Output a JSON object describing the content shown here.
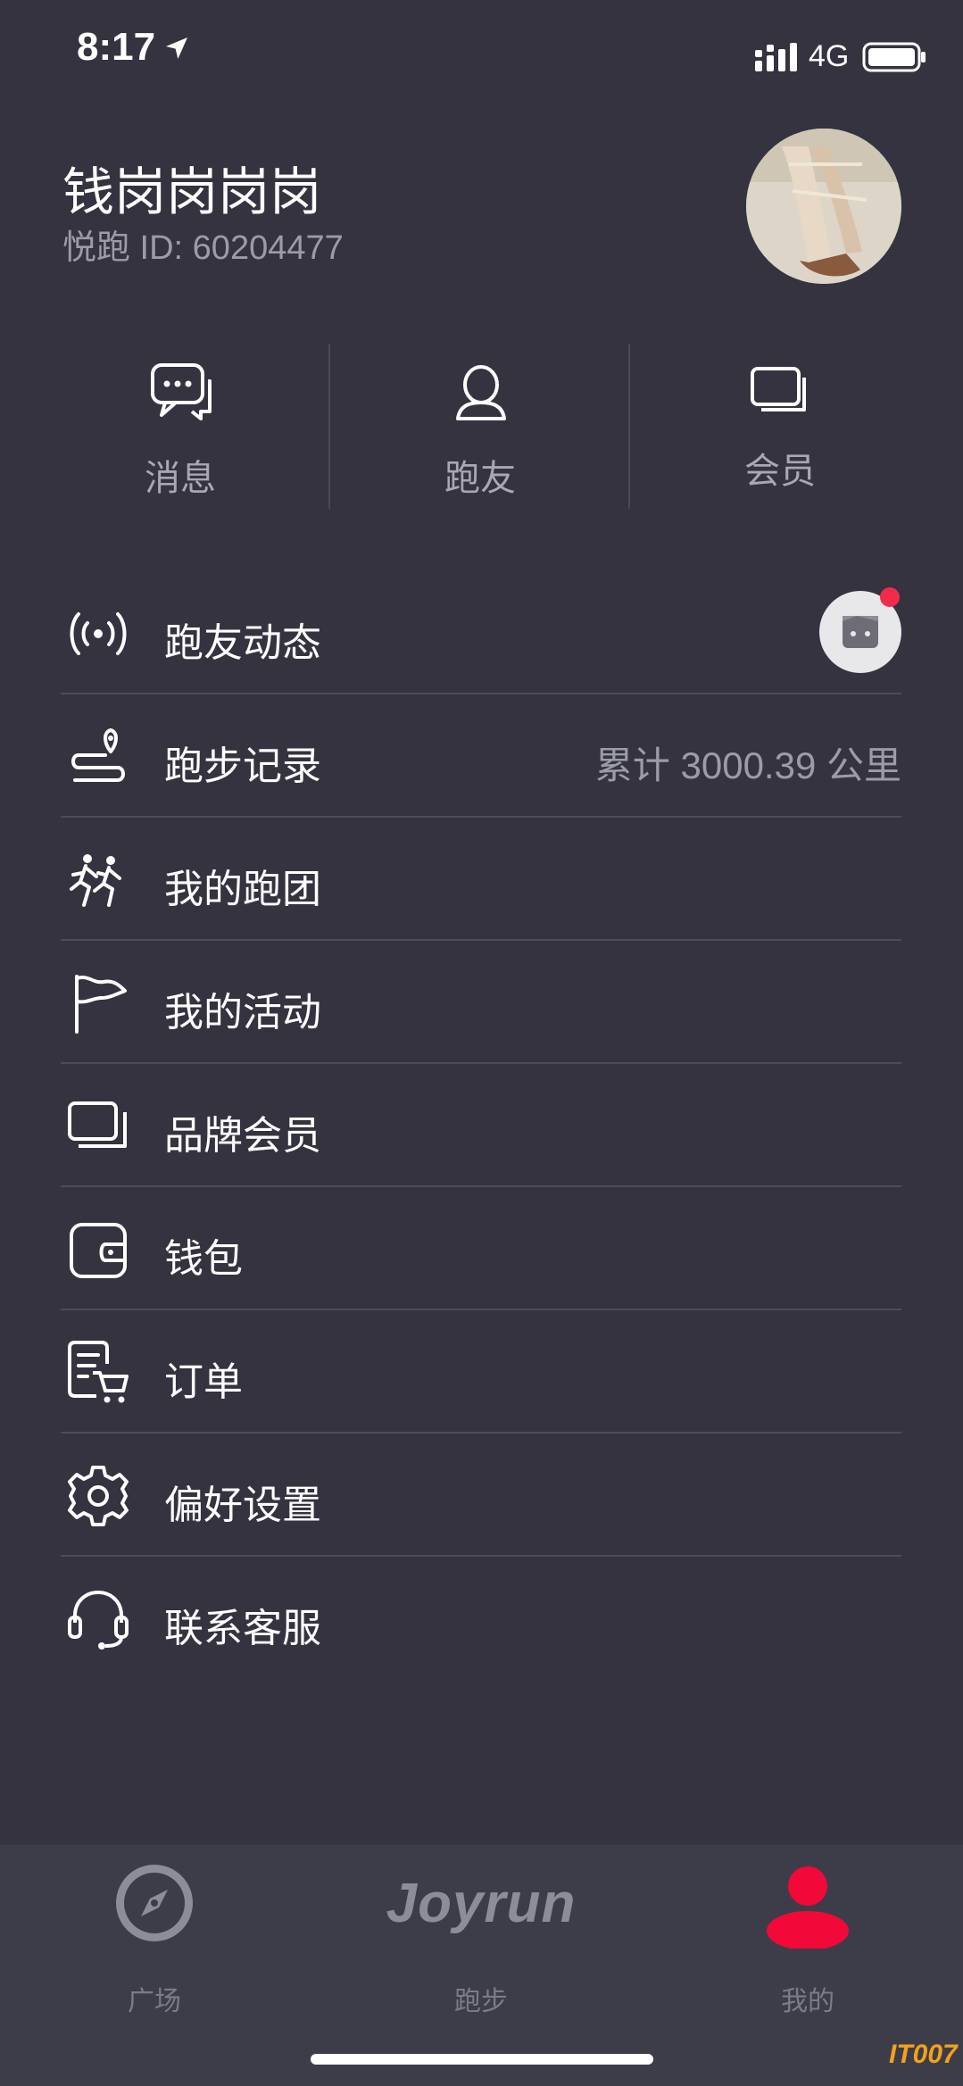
{
  "status_bar": {
    "time": "8:17",
    "network": "4G"
  },
  "profile": {
    "name": "钱岗岗岗岗",
    "id_text": "悦跑 ID: 60204477"
  },
  "quick_actions": [
    {
      "label": "消息",
      "icon": "chat-bubble-icon"
    },
    {
      "label": "跑友",
      "icon": "person-icon"
    },
    {
      "label": "会员",
      "icon": "cards-icon"
    }
  ],
  "menu": [
    {
      "label": "跑友动态",
      "icon": "broadcast-icon",
      "value": ""
    },
    {
      "label": "跑步记录",
      "icon": "route-pin-icon",
      "value": "累计 3000.39 公里"
    },
    {
      "label": "我的跑团",
      "icon": "runners-icon",
      "value": ""
    },
    {
      "label": "我的活动",
      "icon": "flag-icon",
      "value": ""
    },
    {
      "label": "品牌会员",
      "icon": "cards-icon",
      "value": ""
    },
    {
      "label": "钱包",
      "icon": "wallet-icon",
      "value": ""
    },
    {
      "label": "订单",
      "icon": "order-cart-icon",
      "value": ""
    },
    {
      "label": "偏好设置",
      "icon": "gear-icon",
      "value": ""
    },
    {
      "label": "联系客服",
      "icon": "headset-icon",
      "value": ""
    }
  ],
  "tabbar": {
    "tabs": [
      {
        "label": "广场",
        "icon": "compass-icon"
      },
      {
        "label": "跑步",
        "logo": "Joyrun"
      },
      {
        "label": "我的",
        "icon": "user-icon"
      }
    ]
  },
  "watermark": "IT007",
  "colors": {
    "background": "#34333f",
    "tabbar": "#3d3c49",
    "accent": "#f22a4b",
    "muted": "#9c9ba8"
  }
}
